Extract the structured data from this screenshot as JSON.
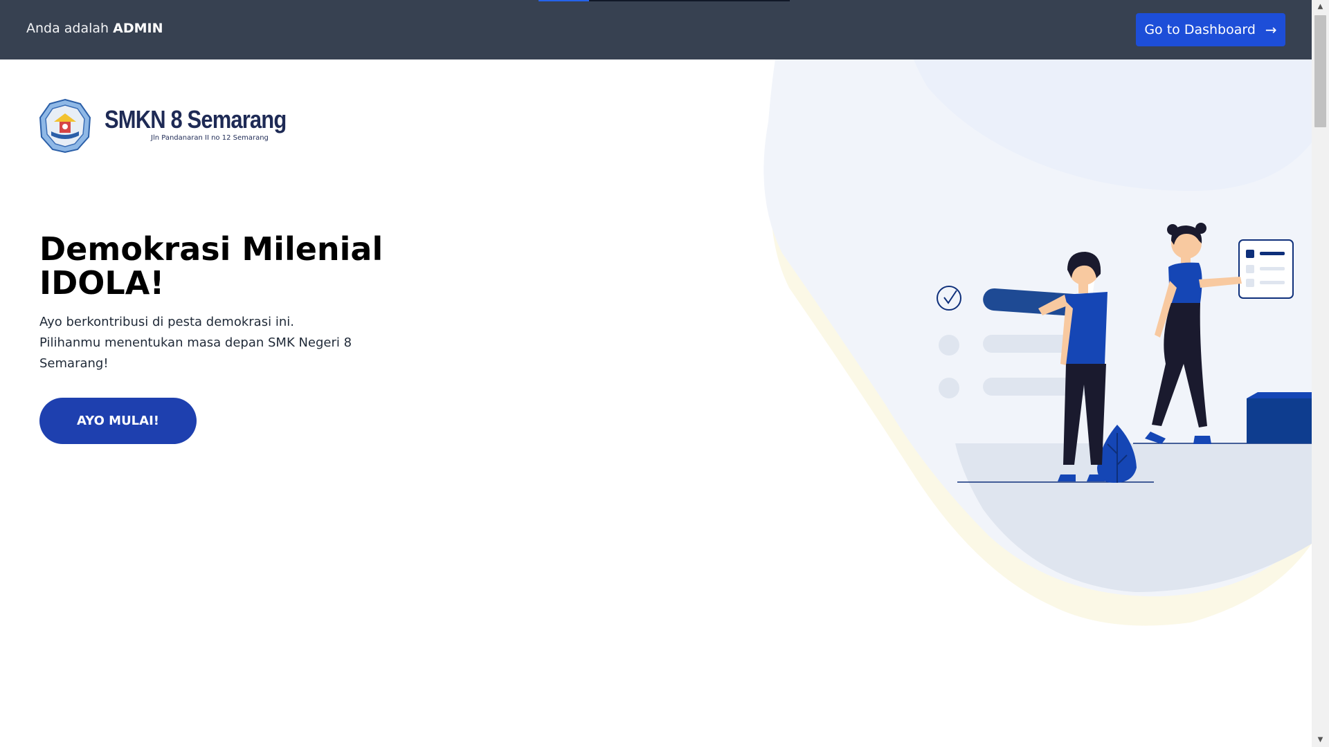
{
  "top_bar": {
    "role_prefix": "Anda adalah",
    "role": "ADMIN",
    "dashboard_button_label": "Go to Dashboard",
    "dashboard_button_icon": "arrow-right-icon",
    "arrow_glyph": "→",
    "load_progress": 0.2
  },
  "logo": {
    "name": "SMKN 8 Semarang",
    "address": "Jln Pandanaran II no 12 Semarang"
  },
  "hero": {
    "title_line1": "Demokrasi Milenial",
    "title_line2": "IDOLA!",
    "description": "Ayo berkontribusi di pesta demokrasi ini. Pilihanmu menentukan masa depan SMK Negeri 8 Semarang!",
    "cta_label": "AYO MULAI!"
  },
  "colors": {
    "top_bar": "#374151",
    "primary_button": "#1d4ed8",
    "cta": "#1e40af",
    "illustration_blue": "#1546b5",
    "illustration_navy": "#0e2f7a"
  }
}
